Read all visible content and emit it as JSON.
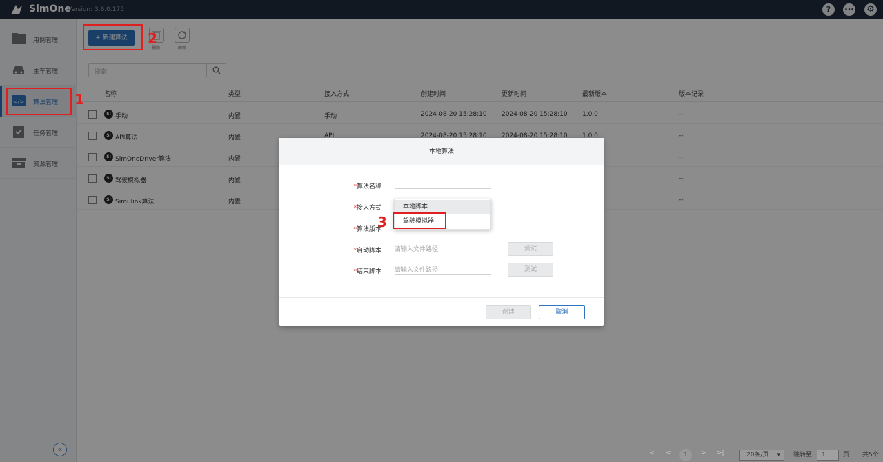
{
  "app": {
    "name": "SimOne",
    "version": "Version: 3.6.0.175"
  },
  "topbar": {
    "help_icon": "?",
    "more_icon": "•••",
    "settings_icon": "⚙"
  },
  "sidebar": {
    "items": [
      {
        "label": "用例管理",
        "icon": "folder-icon"
      },
      {
        "label": "主车管理",
        "icon": "car-icon"
      },
      {
        "label": "算法管理",
        "icon": "code-icon"
      },
      {
        "label": "任务管理",
        "icon": "task-icon"
      },
      {
        "label": "资源管理",
        "icon": "archive-icon"
      }
    ],
    "collapse_icon": "«"
  },
  "toolbar": {
    "new_label": "+ 新建算法",
    "delete_label": "删除",
    "refresh_label": "刷新"
  },
  "search": {
    "placeholder": "搜索"
  },
  "table": {
    "headers": [
      "名称",
      "类型",
      "接入方式",
      "创建时间",
      "更新时间",
      "最新版本",
      "版本记录"
    ],
    "rows": [
      {
        "name": "手动",
        "type": "内置",
        "access": "手动",
        "created": "2024-08-20 15:28:10",
        "updated": "2024-08-20 15:28:10",
        "latest": "1.0.0",
        "history": "--"
      },
      {
        "name": "API算法",
        "type": "内置",
        "access": "API",
        "created": "2024-08-20 15:28:10",
        "updated": "2024-08-20 15:28:10",
        "latest": "1.0.0",
        "history": "--"
      },
      {
        "name": "SimOneDriver算法",
        "type": "内置",
        "access": "",
        "created": "",
        "updated": "",
        "latest": "",
        "history": "--"
      },
      {
        "name": "驾驶模拟器",
        "type": "内置",
        "access": "",
        "created": "",
        "updated": "",
        "latest": "",
        "history": "--"
      },
      {
        "name": "Simulink算法",
        "type": "内置",
        "access": "",
        "created": "",
        "updated": "",
        "latest": "",
        "history": "--"
      }
    ]
  },
  "pagination": {
    "first": "|<",
    "prev": "<",
    "page": "1",
    "next": ">",
    "last": ">|",
    "page_size": "20条/页",
    "goto_label": "跳转至",
    "goto_value": "1",
    "page_unit": "页",
    "total": "共5个"
  },
  "modal": {
    "title": "本地算法",
    "fields": {
      "name_label": "算法名称",
      "access_label": "接入方式",
      "version_label": "算法版本",
      "start_label": "启动脚本",
      "end_label": "结束脚本",
      "path_placeholder": "请输入文件路径",
      "test_label": "测试"
    },
    "dropdown": [
      "本地脚本",
      "驾驶模拟器"
    ],
    "create_label": "创建",
    "cancel_label": "取消"
  },
  "annotations": [
    "1",
    "2",
    "3"
  ],
  "colors": {
    "accent": "#2f74c0",
    "topbar": "#1f2d3d",
    "annotation": "#e02020"
  }
}
